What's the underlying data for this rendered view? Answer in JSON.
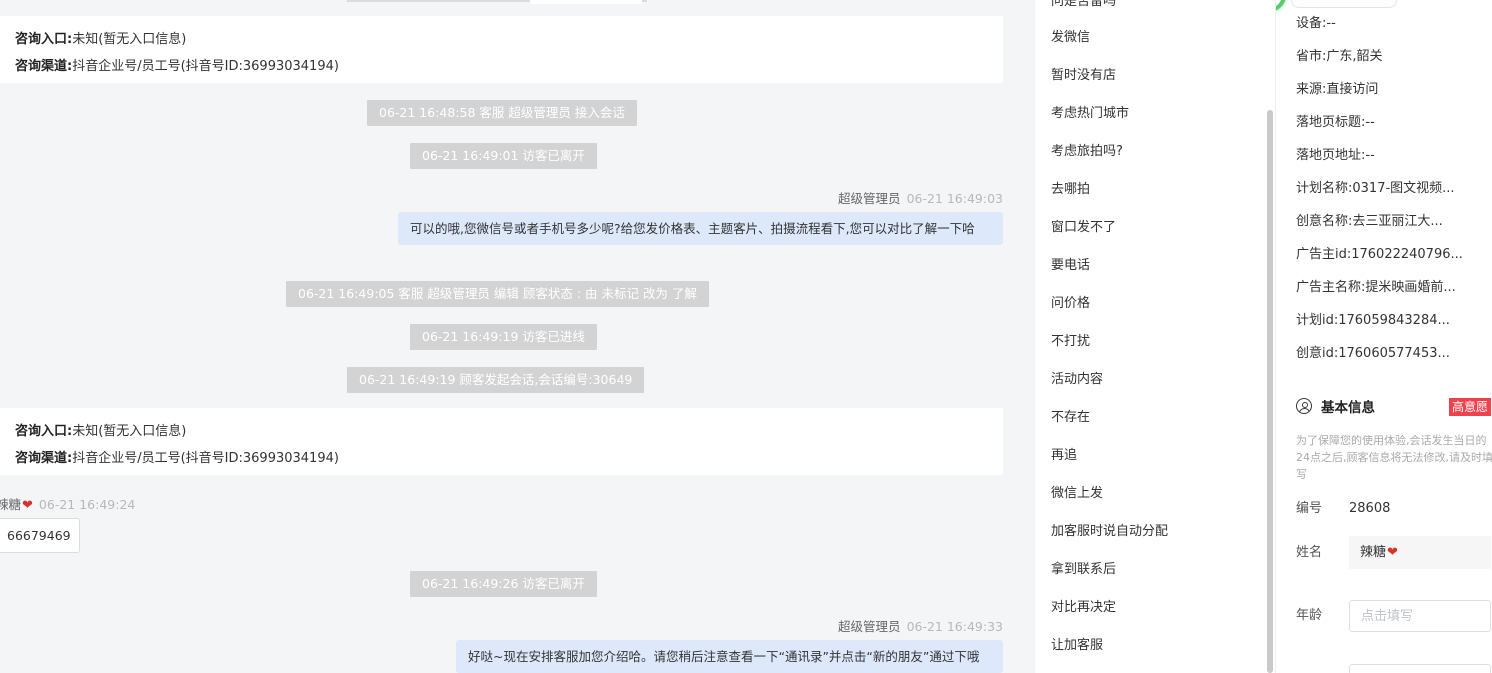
{
  "chat": {
    "info_cards": [
      {
        "entry_label": "咨询入口:",
        "entry_value": "未知(暂无入口信息)",
        "channel_label": "咨询渠道:",
        "channel_value": "抖音企业号/员工号(抖音号ID:36993034194)"
      },
      {
        "entry_label": "咨询入口:",
        "entry_value": "未知(暂无入口信息)",
        "channel_label": "咨询渠道:",
        "channel_value": "抖音企业号/员工号(抖音号ID:36993034194)"
      }
    ],
    "system_messages": [
      "06-21 16:48:58 客服 超级管理员 接入会话",
      "06-21 16:49:01 访客已离开",
      "06-21 16:49:05 客服 超级管理员 编辑 顾客状态 : 由 未标记 改为 了解",
      "06-21 16:49:19 访客已进线",
      "06-21 16:49:19 顾客发起会话,会话编号:30649",
      "06-21 16:49:26 访客已离开"
    ],
    "agent_messages": [
      {
        "sender": "超级管理员",
        "time": "06-21 16:49:03",
        "text": "可以的哦,您微信号或者手机号多少呢?给您发价格表、主题客片、拍摄流程看下,您可以对比了解一下哈"
      },
      {
        "sender": "超级管理员",
        "time": "06-21 16:49:33",
        "text": "好哒~现在安排客服加您介绍哈。请您稍后注意查看一下“通讯录”并点击“新的朋友”通过下哦"
      }
    ],
    "visitor_message": {
      "sender": "辣糖",
      "time": "06-21 16:49:24",
      "text": "66679469"
    }
  },
  "quick_replies": {
    "items": [
      "问是否留吗",
      "发微信",
      "暂时没有店",
      "考虑热门城市",
      "考虑旅拍吗?",
      "去哪拍",
      "窗口发不了",
      "要电话",
      "问价格",
      "不打扰",
      "活动内容",
      "不存在",
      "再追",
      "微信上发",
      "加客服时说自动分配",
      "拿到联系后",
      "对比再决定",
      "让加客服"
    ]
  },
  "panel": {
    "fields": [
      "设备:--",
      "省市:广东,韶关",
      "来源:直接访问",
      "落地页标题:--",
      "落地页地址:--",
      "计划名称:0317-图文视频...",
      "创意名称:去三亚丽江大...",
      "广告主id:176022240796...",
      "广告主名称:提米映画婚前...",
      "计划id:176059843284...",
      "创意id:176060577453..."
    ],
    "basic_info_title": "基本信息",
    "badge": "高意愿",
    "notice": "为了保障您的使用体验,会话发生当日的24点之后,顾客信息将无法修改,请及时填写",
    "number_label": "编号",
    "number_value": "28608",
    "name_label": "姓名",
    "name_value": "辣糖",
    "age_label": "年龄",
    "age_placeholder": "点击填写"
  }
}
